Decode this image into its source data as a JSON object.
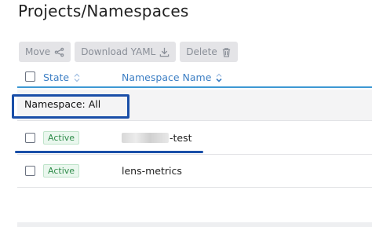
{
  "page": {
    "title": "Projects/Namespaces"
  },
  "toolbar": {
    "move_label": "Move",
    "download_label": "Download YAML",
    "delete_label": "Delete"
  },
  "table": {
    "headers": {
      "state": "State",
      "namespace_name": "Namespace Name"
    },
    "group": {
      "label": "Namespace: All"
    },
    "rows": [
      {
        "state": "Active",
        "name_suffix": "-test",
        "name_redacted": true
      },
      {
        "state": "Active",
        "name": "lens-metrics"
      }
    ]
  },
  "colors": {
    "accent": "#3d98d3",
    "annotation": "#1a4fa8",
    "active_green": "#2f8c4a"
  }
}
